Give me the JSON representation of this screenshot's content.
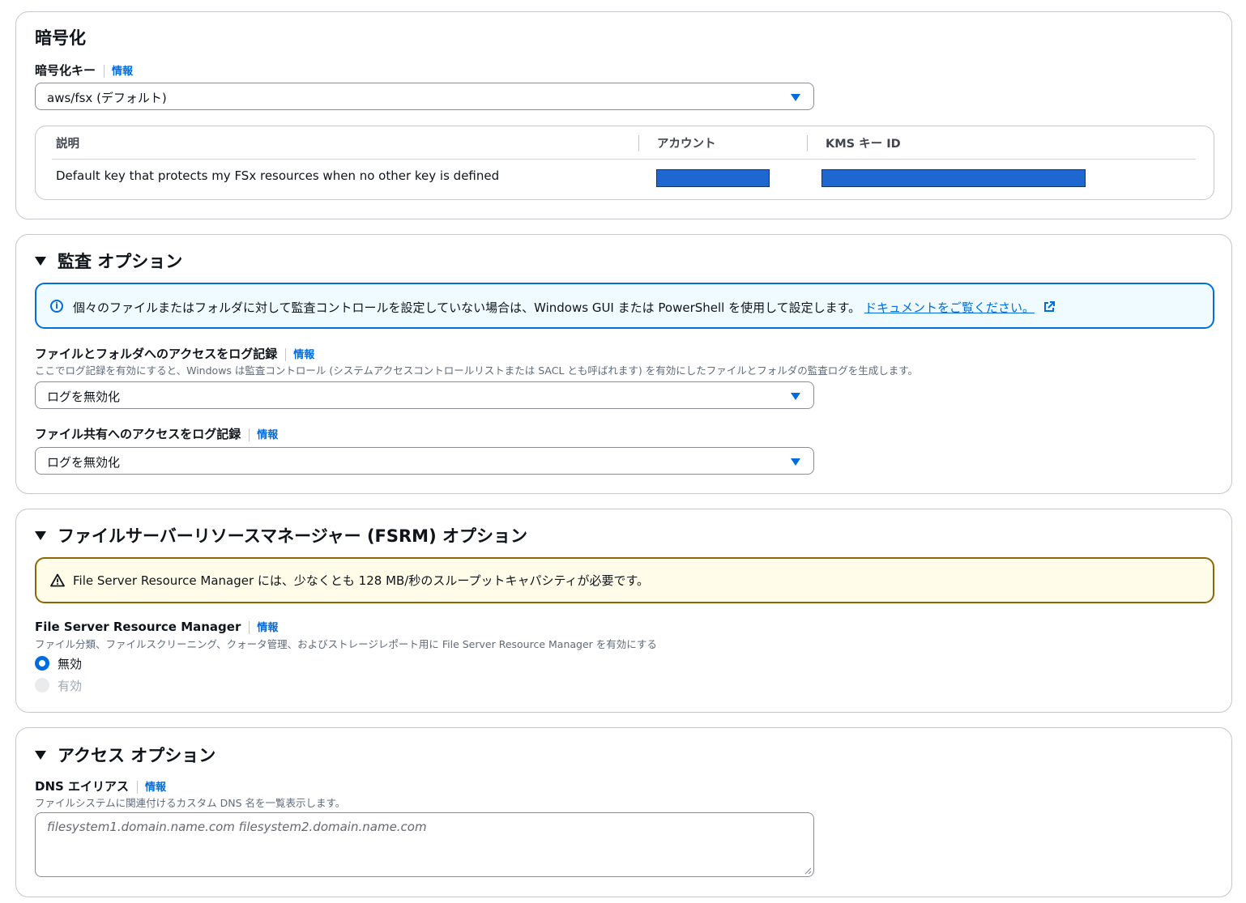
{
  "encryption": {
    "title": "暗号化",
    "key_label": "暗号化キー",
    "info": "情報",
    "key_value": "aws/fsx (デフォルト)",
    "table": {
      "col_description": "説明",
      "col_account": "アカウント",
      "col_kms_key_id": "KMS キー ID",
      "row_description": "Default key that protects my FSx resources when no other key is defined"
    }
  },
  "audit": {
    "title": "監査 オプション",
    "alert_text": "個々のファイルまたはフォルダに対して監査コントロールを設定していない場合は、Windows GUI または PowerShell を使用して設定します。",
    "alert_link": "ドキュメントをご覧ください。",
    "file_access_label": "ファイルとフォルダへのアクセスをログ記録",
    "file_access_desc": "ここでログ記録を有効にすると、Windows は監査コントロール (システムアクセスコントロールリストまたは SACL とも呼ばれます) を有効にしたファイルとフォルダの監査ログを生成します。",
    "file_access_value": "ログを無効化",
    "share_access_label": "ファイル共有へのアクセスをログ記録",
    "share_access_value": "ログを無効化",
    "info": "情報"
  },
  "fsrm": {
    "title": "ファイルサーバーリソースマネージャー (FSRM) オプション",
    "warning_text": "File Server Resource Manager には、少なくとも 128 MB/秒のスループットキャパシティが必要です。",
    "label": "File Server Resource Manager",
    "info": "情報",
    "desc": "ファイル分類、ファイルスクリーニング、クォータ管理、およびストレージレポート用に File Server Resource Manager を有効にする",
    "option_disabled": "無効",
    "option_enabled": "有効",
    "selected": "無効"
  },
  "access": {
    "title": "アクセス オプション",
    "dns_label": "DNS エイリアス",
    "info": "情報",
    "dns_desc": "ファイルシステムに関連付けるカスタム DNS 名を一覧表示します。",
    "dns_placeholder": "filesystem1.domain.name.com filesystem2.domain.name.com"
  },
  "colors": {
    "link": "#006ce0",
    "info_border": "#0070d8",
    "warning_border": "#8d6605",
    "redaction": "#1f67d0"
  }
}
